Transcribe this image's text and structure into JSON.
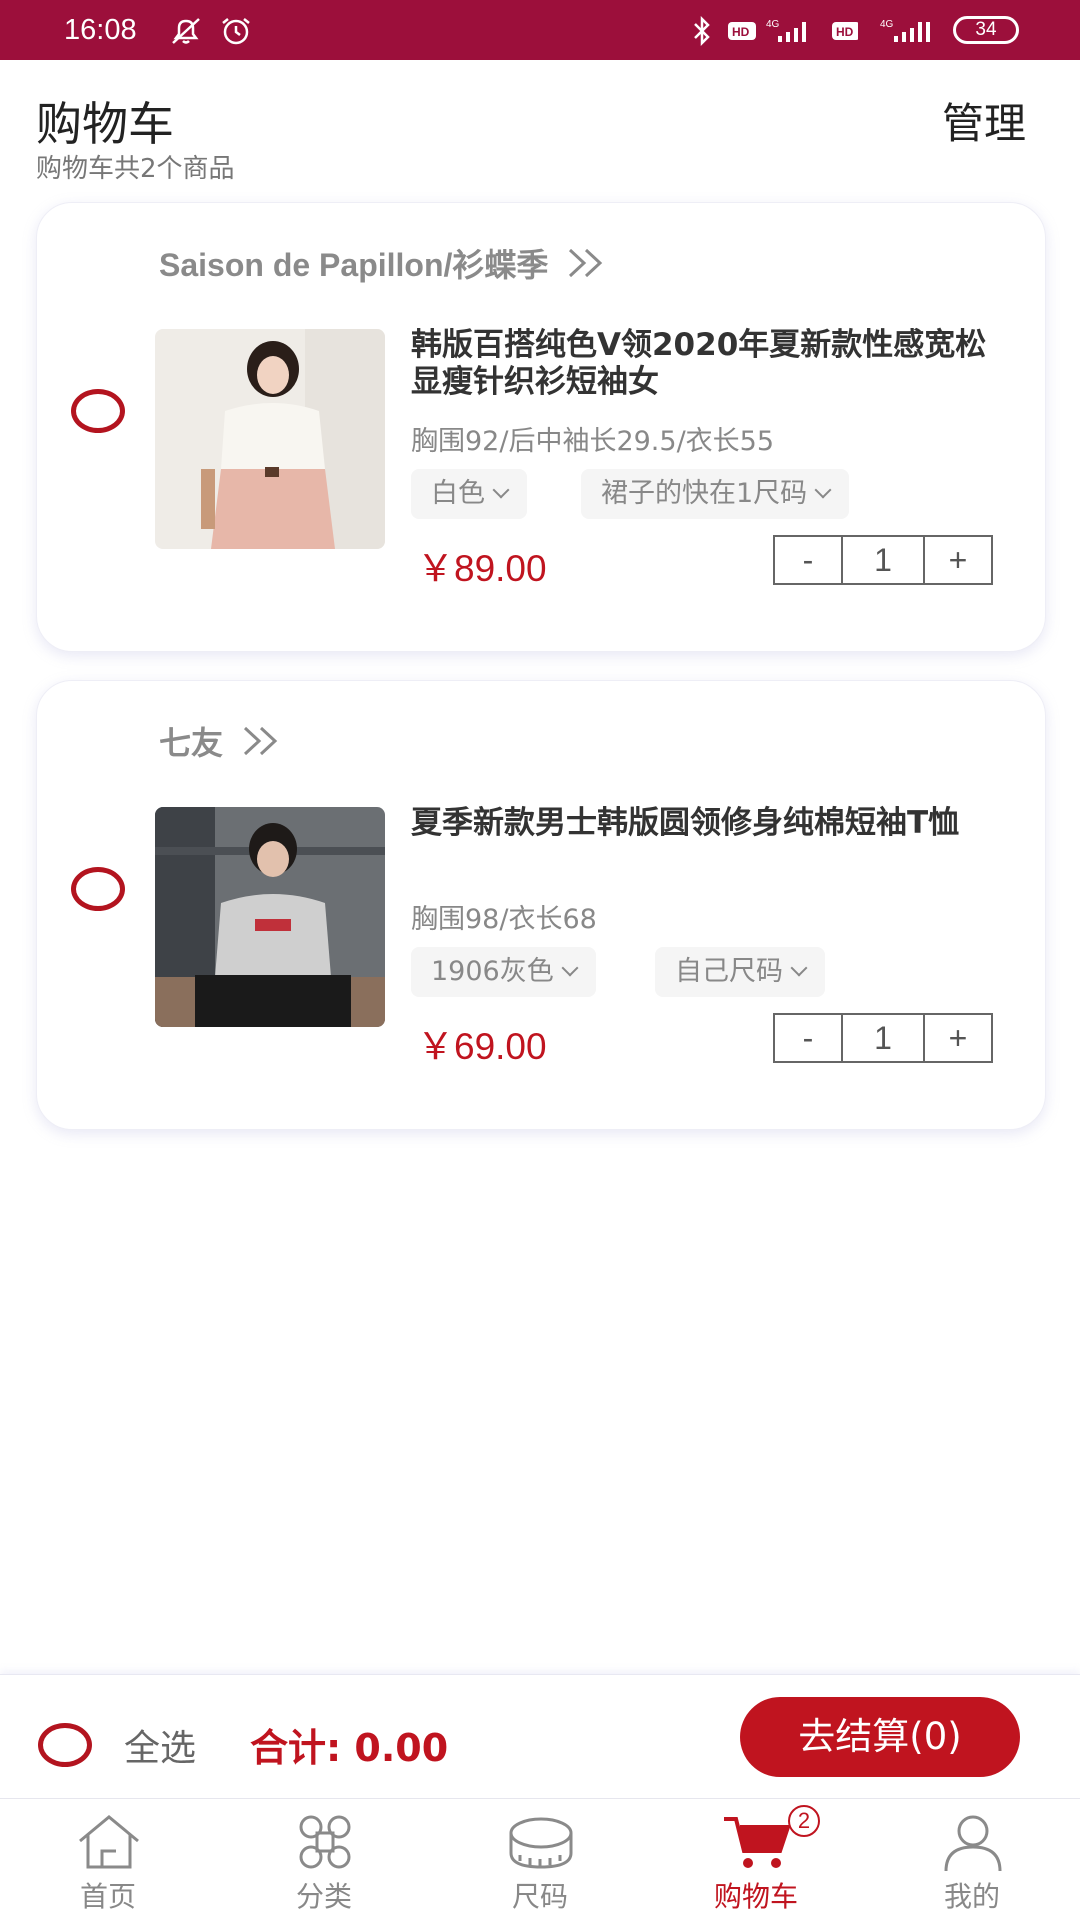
{
  "status_bar": {
    "time": "16:08",
    "battery": "34"
  },
  "header": {
    "title": "购物车",
    "subtitle": "购物车共2个商品",
    "manage": "管理"
  },
  "cart": [
    {
      "shop": "Saison de Papillon/衫蝶季",
      "title": "韩版百搭纯色V领2020年夏新款性感宽松显瘦针织衫短袖女",
      "spec": "胸围92/后中袖长29.5/衣长55",
      "options": [
        "白色",
        "裙子的快在1尺码"
      ],
      "price": "￥89.00",
      "quantity": "1",
      "minus": "-",
      "plus": "+"
    },
    {
      "shop": "七友",
      "title": "夏季新款男士韩版圆领修身纯棉短袖T恤",
      "spec": "胸围98/衣长68",
      "options": [
        "1906灰色",
        "自己尺码"
      ],
      "price": "￥69.00",
      "quantity": "1",
      "minus": "-",
      "plus": "+"
    }
  ],
  "footer": {
    "select_all": "全选",
    "total": "合计: 0.00",
    "checkout": "去结算(0)"
  },
  "tabs": [
    {
      "label": "首页",
      "icon": "home-icon"
    },
    {
      "label": "分类",
      "icon": "category-icon"
    },
    {
      "label": "尺码",
      "icon": "tape-measure-icon"
    },
    {
      "label": "购物车",
      "icon": "cart-icon",
      "badge": "2",
      "active": true
    },
    {
      "label": "我的",
      "icon": "profile-icon"
    }
  ],
  "colors": {
    "brand": "#9c0f3b",
    "accent": "#c0141f"
  }
}
